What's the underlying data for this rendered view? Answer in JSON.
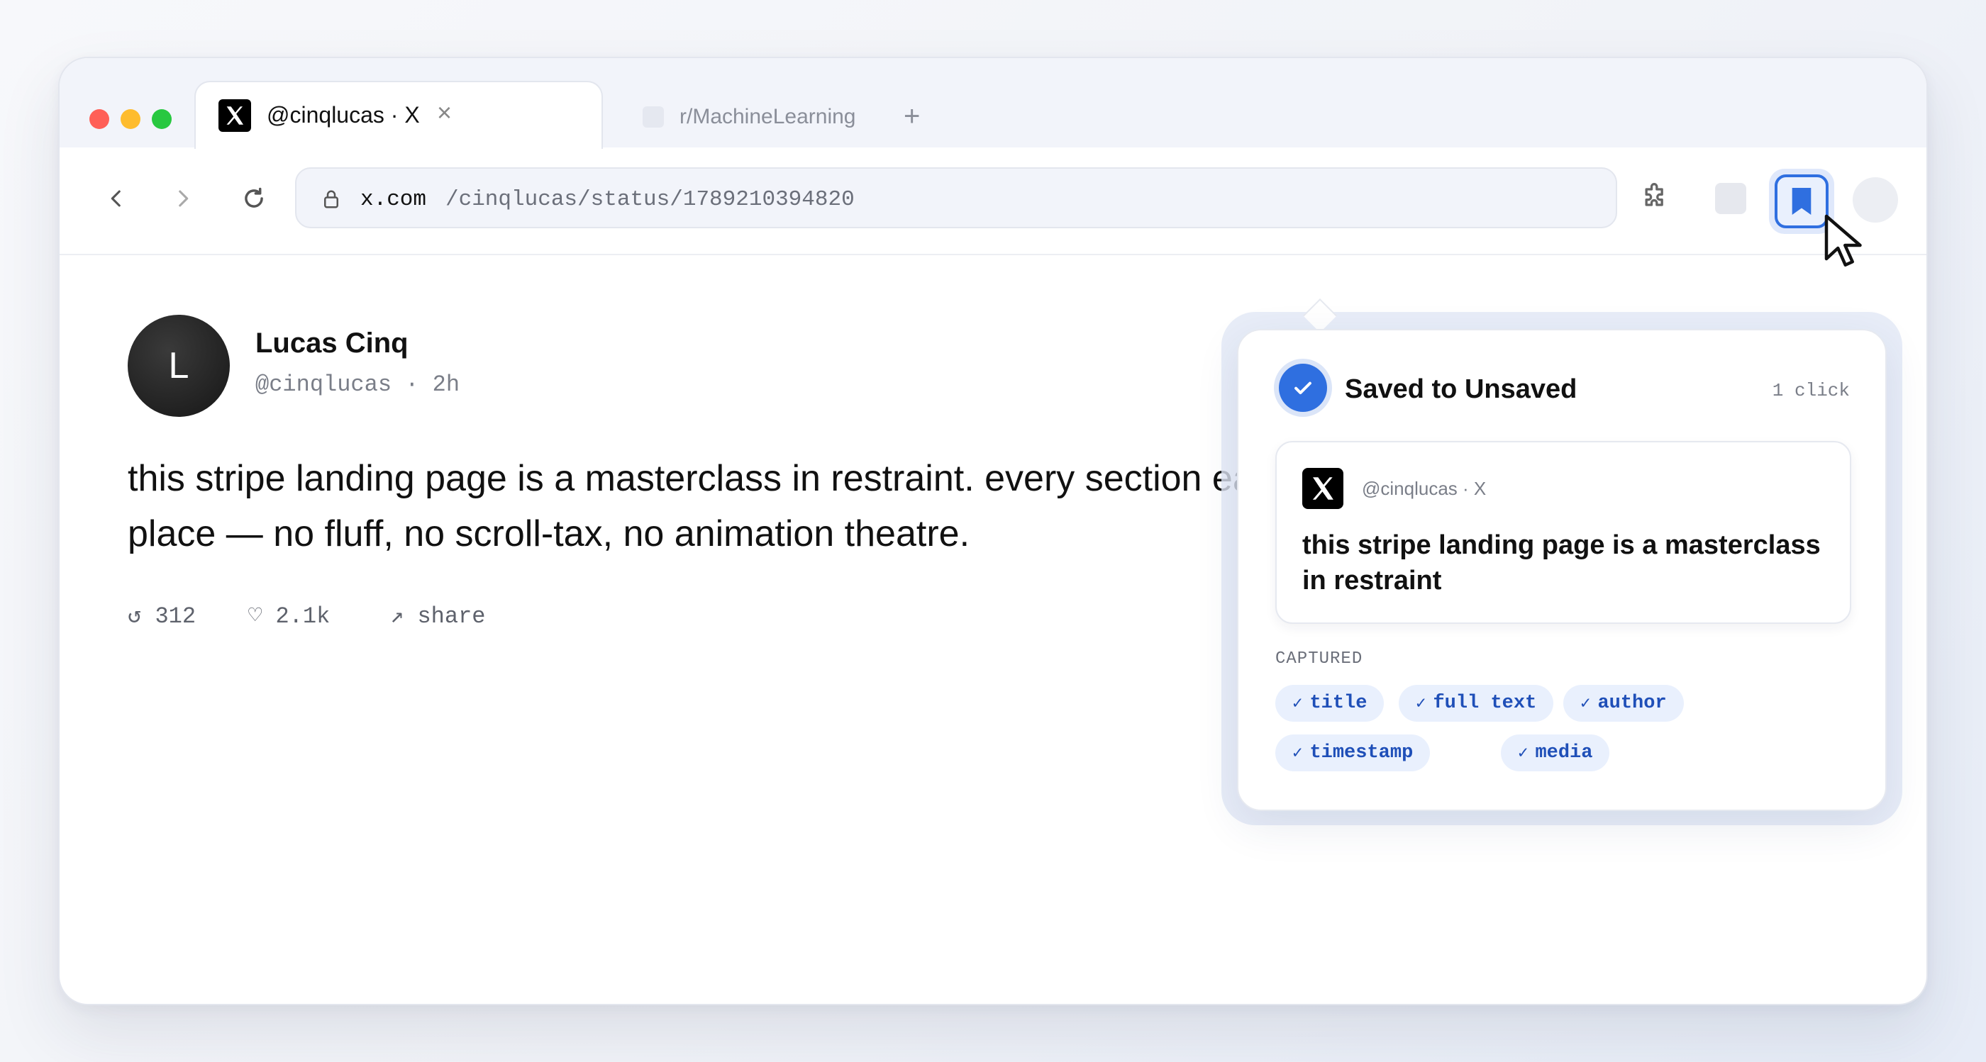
{
  "browser": {
    "active_tab": {
      "title": "@cinqlucas · X",
      "favicon": "x-logo-icon"
    },
    "inactive_tab": {
      "title": "r/MachineLearning"
    },
    "new_tab_label": "+",
    "close_tab_label": "×",
    "url": {
      "domain": "x.com",
      "path": "/cinqlucas/status/1789210394820"
    }
  },
  "post": {
    "avatar_letter": "L",
    "author_name": "Lucas Cinq",
    "author_meta": "@cinqlucas · 2h",
    "text": "this stripe landing page is a masterclass in restraint. every section earns its\nplace — no fluff, no scroll-tax, no animation theatre.",
    "stats": {
      "repost": "↺ 312",
      "like": "♡ 2.1k",
      "share": "↗ share"
    }
  },
  "popup": {
    "title": "Saved to Unsaved",
    "clicks": "1 click",
    "card_source": "@cinqlucas · X",
    "card_text": "this stripe landing page is a masterclass in restraint",
    "captured_label": "CAPTURED",
    "chips": [
      "title",
      "full text",
      "author",
      "timestamp",
      "media"
    ],
    "chip_check": "✓"
  },
  "colors": {
    "accent": "#2f6fe0",
    "chip_bg": "#e9f0fd",
    "chip_text": "#1f4fb8"
  }
}
